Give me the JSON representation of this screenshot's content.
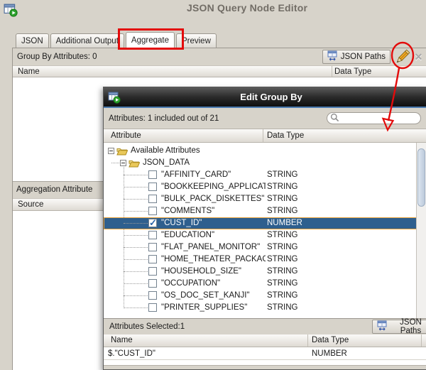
{
  "window": {
    "title": "JSON Query Node Editor",
    "tabs": {
      "json": "JSON",
      "additional_output": "Additional Output",
      "aggregate": "Aggregate",
      "preview": "Preview"
    },
    "group_by": {
      "summary": "Group By Attributes: 0",
      "json_paths_button": "JSON Paths",
      "columns": {
        "name": "Name",
        "data_type": "Data Type"
      }
    },
    "aggregation": {
      "header": "Aggregation Attribute",
      "columns": {
        "source": "Source"
      }
    }
  },
  "dialog": {
    "title": "Edit Group By",
    "summary": "Attributes: 1 included out of 21",
    "search_value": "",
    "columns": {
      "attribute": "Attribute",
      "data_type": "Data Type"
    },
    "tree": {
      "root_label": "Available Attributes",
      "group_label": "JSON_DATA",
      "items": [
        {
          "name": "\"AFFINITY_CARD\"",
          "type": "STRING",
          "checked": false
        },
        {
          "name": "\"BOOKKEEPING_APPLICATION\"",
          "type": "STRING",
          "checked": false
        },
        {
          "name": "\"BULK_PACK_DISKETTES\"",
          "type": "STRING",
          "checked": false
        },
        {
          "name": "\"COMMENTS\"",
          "type": "STRING",
          "checked": false
        },
        {
          "name": "\"CUST_ID\"",
          "type": "NUMBER",
          "checked": true,
          "selected": true
        },
        {
          "name": "\"EDUCATION\"",
          "type": "STRING",
          "checked": false
        },
        {
          "name": "\"FLAT_PANEL_MONITOR\"",
          "type": "STRING",
          "checked": false
        },
        {
          "name": "\"HOME_THEATER_PACKAGE\"",
          "type": "STRING",
          "checked": false
        },
        {
          "name": "\"HOUSEHOLD_SIZE\"",
          "type": "STRING",
          "checked": false
        },
        {
          "name": "\"OCCUPATION\"",
          "type": "STRING",
          "checked": false
        },
        {
          "name": "\"OS_DOC_SET_KANJI\"",
          "type": "STRING",
          "checked": false
        },
        {
          "name": "\"PRINTER_SUPPLIES\"",
          "type": "STRING",
          "checked": false
        }
      ]
    },
    "footer": {
      "summary": "Attributes Selected:1",
      "json_paths_button": "JSON Paths",
      "columns": {
        "name": "Name",
        "data_type": "Data Type"
      },
      "rows": [
        {
          "name": "$.\"CUST_ID\"",
          "type": "NUMBER"
        }
      ]
    }
  },
  "colors": {
    "selection_blue": "#2e5f8e",
    "focus_ring_orange": "#e8a33c",
    "annotation_red": "#e30b0b",
    "titlebar_accent_blue": "#4a7ab0"
  }
}
